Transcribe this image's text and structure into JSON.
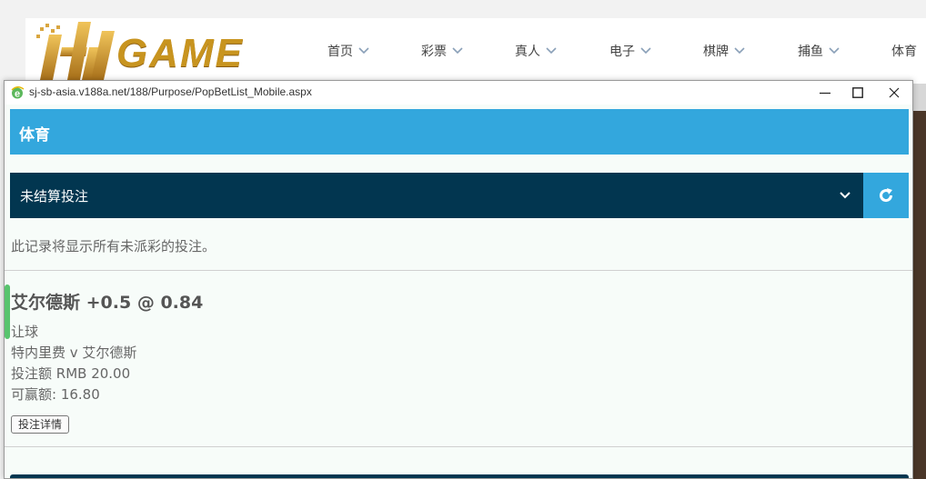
{
  "site": {
    "logo_text": "GAME",
    "nav": [
      {
        "label": "首页"
      },
      {
        "label": "彩票"
      },
      {
        "label": "真人"
      },
      {
        "label": "电子"
      },
      {
        "label": "棋牌"
      },
      {
        "label": "捕鱼"
      },
      {
        "label": "体育"
      }
    ]
  },
  "popup": {
    "url": "sj-sb-asia.v188a.net/188/Purpose/PopBetList_Mobile.aspx",
    "sport_title": "体育",
    "status_selected": "未结算投注",
    "note": "此记录将显示所有未派彩的投注。",
    "bet": {
      "selection": "艾尔德斯",
      "handicap": "+0.5",
      "odds_at": "@ 0.84",
      "market": "让球",
      "match": "特内里费 v 艾尔德斯",
      "stake": "投注额 RMB 20.00",
      "payout": "可赢额: 16.80",
      "details_label": "投注详情"
    }
  },
  "colors": {
    "accent_blue": "#33a7dd",
    "dark_navy": "#023650",
    "logo_gold": "#c8941f"
  },
  "icons": {
    "browser": "ie-icon",
    "minimize": "minimize-icon",
    "maximize": "maximize-icon",
    "close": "close-icon",
    "dropdown": "chevron-down-icon",
    "refresh": "refresh-icon"
  }
}
